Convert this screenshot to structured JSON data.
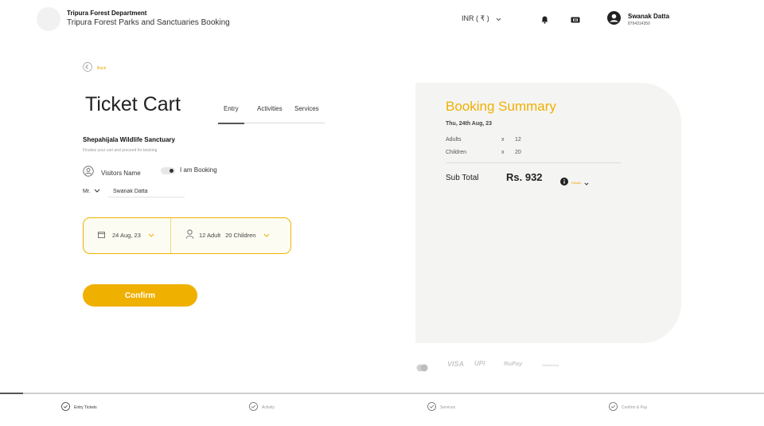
{
  "header": {
    "org_title": "Tripura Forest Department",
    "org_subtitle": "Tripura Forest Parks and Sanctuaries Booking",
    "currency": "INR ( ₹ )",
    "user_name": "Swanak Datta",
    "user_phone": "8794314350"
  },
  "back_label": "Back",
  "page_title": "Ticket Cart",
  "tabs": [
    {
      "label": "Entry",
      "active": true
    },
    {
      "label": "Activities",
      "active": false
    },
    {
      "label": "Services",
      "active": false
    }
  ],
  "sanctuary": {
    "name": "Shepahijala Wildlife Sanctuary",
    "subtitle": "Finalise your cart and proceed for booking"
  },
  "visitors": {
    "label": "Visitors Name",
    "toggle_label": "I am Booking",
    "toggle_on": true,
    "salutation": "Mr.",
    "name_value": "Swanak Datta"
  },
  "selector": {
    "date": "24 Aug, 23",
    "adults": "12 Adult",
    "children": "20 Children"
  },
  "confirm_label": "Confirm",
  "summary": {
    "title": "Booking Summary",
    "date": "Thu, 24th Aug, 23",
    "rows": [
      {
        "label": "Adults",
        "x": "x",
        "value": "12"
      },
      {
        "label": "Children",
        "x": "x",
        "value": "20"
      }
    ],
    "subtotal_label": "Sub Total",
    "subtotal_amount": "Rs. 932",
    "details_label": "Details"
  },
  "payments": [
    "VISA",
    "UPI",
    "RuPay",
    "NetBanking"
  ],
  "steps": [
    {
      "label": "Entry Tickets",
      "active": true
    },
    {
      "label": "Activity",
      "active": false
    },
    {
      "label": "Services",
      "active": false
    },
    {
      "label": "Confirm & Pay",
      "active": false
    }
  ],
  "progress": 0.03,
  "colors": {
    "accent": "#f0b000",
    "panel": "#f4f4f2"
  }
}
